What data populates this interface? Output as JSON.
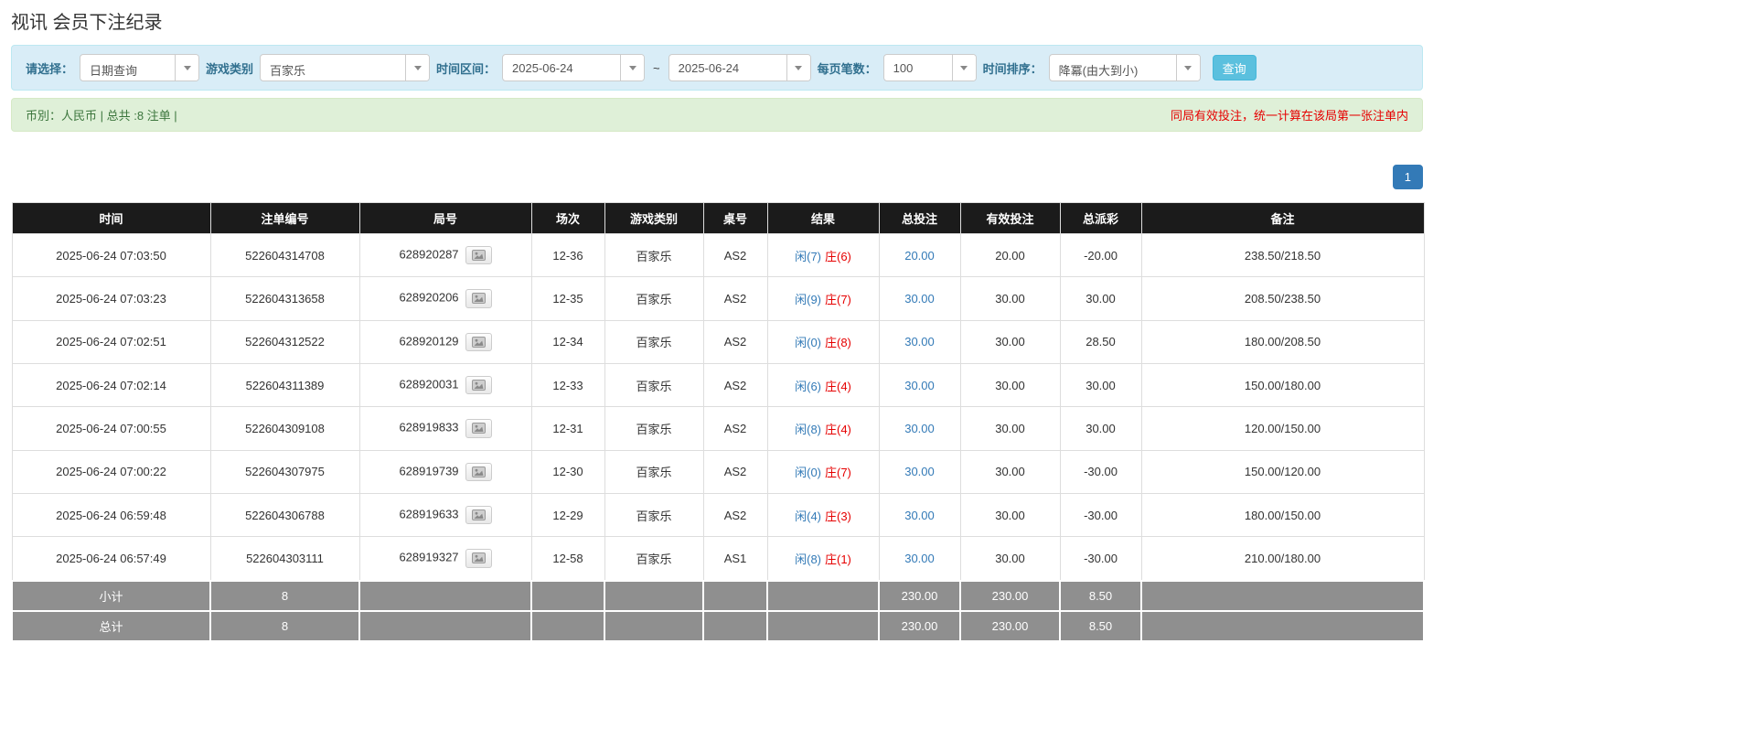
{
  "page": {
    "title": "视讯 会员下注纪录"
  },
  "filters": {
    "select_label": "请选择：",
    "select_value": "日期查询",
    "game_type_label": "游戏类别",
    "game_type_value": "百家乐",
    "time_range_label": "时间区间：",
    "date_from": "2025-06-24",
    "tilde": "~",
    "date_to": "2025-06-24",
    "page_size_label": "每页笔数：",
    "page_size_value": "100",
    "sort_label": "时间排序：",
    "sort_value": "降冪(由大到小)",
    "search_button": "查询"
  },
  "summary": {
    "left": "币別：人民币 | 总共 :8 注单 |",
    "right": "同局有效投注，统一计算在该局第一张注单内"
  },
  "pagination": {
    "current": "1"
  },
  "colors": {
    "link_blue": "#337ab7",
    "player_blue": "#337ab7",
    "banker_red": "#e60000",
    "negative_red": "#e60000",
    "summary_green": "#3c763d",
    "warning_red": "#e60000",
    "search_button_blue": "#5bc0de",
    "table_header_bg": "#1b1b1b",
    "table_footer_gray": "#8f8f8f",
    "filter_bar_bg": "#d9edf7",
    "summary_bar_bg": "#dff0d8"
  },
  "table": {
    "headers": [
      "时间",
      "注单编号",
      "局号",
      "场次",
      "游戏类别",
      "桌号",
      "结果",
      "总投注",
      "有效投注",
      "总派彩",
      "备注"
    ],
    "rows": [
      {
        "time": "2025-06-24 07:03:50",
        "bet_id": "522604314708",
        "round_id": "628920287",
        "session": "12-36",
        "game": "百家乐",
        "table_no": "AS2",
        "result_player": "闲(7)",
        "result_banker": "庄(6)",
        "total_bet": "20.00",
        "valid_bet": "20.00",
        "payout": "-20.00",
        "note": "238.50/218.50"
      },
      {
        "time": "2025-06-24 07:03:23",
        "bet_id": "522604313658",
        "round_id": "628920206",
        "session": "12-35",
        "game": "百家乐",
        "table_no": "AS2",
        "result_player": "闲(9)",
        "result_banker": "庄(7)",
        "total_bet": "30.00",
        "valid_bet": "30.00",
        "payout": "30.00",
        "note": "208.50/238.50"
      },
      {
        "time": "2025-06-24 07:02:51",
        "bet_id": "522604312522",
        "round_id": "628920129",
        "session": "12-34",
        "game": "百家乐",
        "table_no": "AS2",
        "result_player": "闲(0)",
        "result_banker": "庄(8)",
        "total_bet": "30.00",
        "valid_bet": "30.00",
        "payout": "28.50",
        "note": "180.00/208.50"
      },
      {
        "time": "2025-06-24 07:02:14",
        "bet_id": "522604311389",
        "round_id": "628920031",
        "session": "12-33",
        "game": "百家乐",
        "table_no": "AS2",
        "result_player": "闲(6)",
        "result_banker": "庄(4)",
        "total_bet": "30.00",
        "valid_bet": "30.00",
        "payout": "30.00",
        "note": "150.00/180.00"
      },
      {
        "time": "2025-06-24 07:00:55",
        "bet_id": "522604309108",
        "round_id": "628919833",
        "session": "12-31",
        "game": "百家乐",
        "table_no": "AS2",
        "result_player": "闲(8)",
        "result_banker": "庄(4)",
        "total_bet": "30.00",
        "valid_bet": "30.00",
        "payout": "30.00",
        "note": "120.00/150.00"
      },
      {
        "time": "2025-06-24 07:00:22",
        "bet_id": "522604307975",
        "round_id": "628919739",
        "session": "12-30",
        "game": "百家乐",
        "table_no": "AS2",
        "result_player": "闲(0)",
        "result_banker": "庄(7)",
        "total_bet": "30.00",
        "valid_bet": "30.00",
        "payout": "-30.00",
        "note": "150.00/120.00"
      },
      {
        "time": "2025-06-24 06:59:48",
        "bet_id": "522604306788",
        "round_id": "628919633",
        "session": "12-29",
        "game": "百家乐",
        "table_no": "AS2",
        "result_player": "闲(4)",
        "result_banker": "庄(3)",
        "total_bet": "30.00",
        "valid_bet": "30.00",
        "payout": "-30.00",
        "note": "180.00/150.00"
      },
      {
        "time": "2025-06-24 06:57:49",
        "bet_id": "522604303111",
        "round_id": "628919327",
        "session": "12-58",
        "game": "百家乐",
        "table_no": "AS1",
        "result_player": "闲(8)",
        "result_banker": "庄(1)",
        "total_bet": "30.00",
        "valid_bet": "30.00",
        "payout": "-30.00",
        "note": "210.00/180.00"
      }
    ],
    "subtotal": {
      "label": "小计",
      "count": "8",
      "total_bet": "230.00",
      "valid_bet": "230.00",
      "payout": "8.50"
    },
    "total": {
      "label": "总计",
      "count": "8",
      "total_bet": "230.00",
      "valid_bet": "230.00",
      "payout": "8.50"
    }
  }
}
